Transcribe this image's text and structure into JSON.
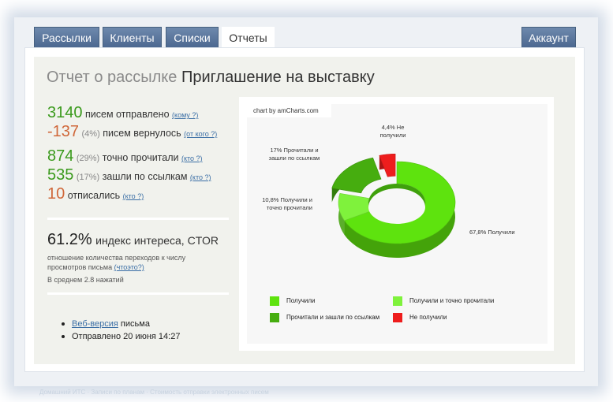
{
  "nav": {
    "tabs": [
      "Рассылки",
      "Клиенты",
      "Списки",
      "Отчеты"
    ],
    "active_tab": "Отчеты",
    "account": "Аккаунт"
  },
  "report": {
    "title_prefix": "Отчет о рассылке",
    "title_name": "Приглашение на выставку"
  },
  "stats": {
    "sent": {
      "value": "3140",
      "label": "писем отправлено",
      "link": "(кому ?)"
    },
    "returned": {
      "value": "-137",
      "pct": "(4%)",
      "label": "писем вернулось",
      "link": "(от кого ?)"
    },
    "read": {
      "value": "874",
      "pct": "(29%)",
      "label": "точно прочитали",
      "link": "(кто ?)"
    },
    "clicked": {
      "value": "535",
      "pct": "(17%)",
      "label": "зашли по ссылкам",
      "link": "(кто ?)"
    },
    "unsubscribed": {
      "value": "10",
      "label": "отписались",
      "link": "(кто ?)"
    }
  },
  "ctor": {
    "value": "61.2%",
    "label": "индекс интереса, CTOR",
    "desc": "отношение количества переходов к числу просмотров письма",
    "desc_link": "(чтоэто?)",
    "avg": "В среднем 2.8 нажатий"
  },
  "info": {
    "web_version_link": "Веб-версия",
    "web_version_suffix": "письма",
    "sent_date": "Отправлено 20 июня 14:27"
  },
  "chart_credit": "chart by amCharts.com",
  "chart_data": {
    "type": "pie",
    "variant": "3d-donut",
    "slices": [
      {
        "name": "Получили",
        "value": 67.8,
        "label": "67,8% Получили",
        "color": "#5ee30e"
      },
      {
        "name": "Получили и точно прочитали",
        "value": 10.8,
        "label": "10,8% Получили и точно прочитали",
        "color": "#7ff23c"
      },
      {
        "name": "Прочитали и зашли по ссылкам",
        "value": 17,
        "label": "17% Прочитали и зашли по ссылкам",
        "color": "#46ad0f"
      },
      {
        "name": "Не получили",
        "value": 4.4,
        "label": "4,4% Не получили",
        "color": "#ee1d1d"
      }
    ],
    "exploded": [
      "Прочитали и зашли по ссылкам",
      "Не получили"
    ],
    "legend_position": "bottom"
  },
  "footer_text": "Домашний ИТС · Записи по планам · Стоимость отправки электронных писем"
}
